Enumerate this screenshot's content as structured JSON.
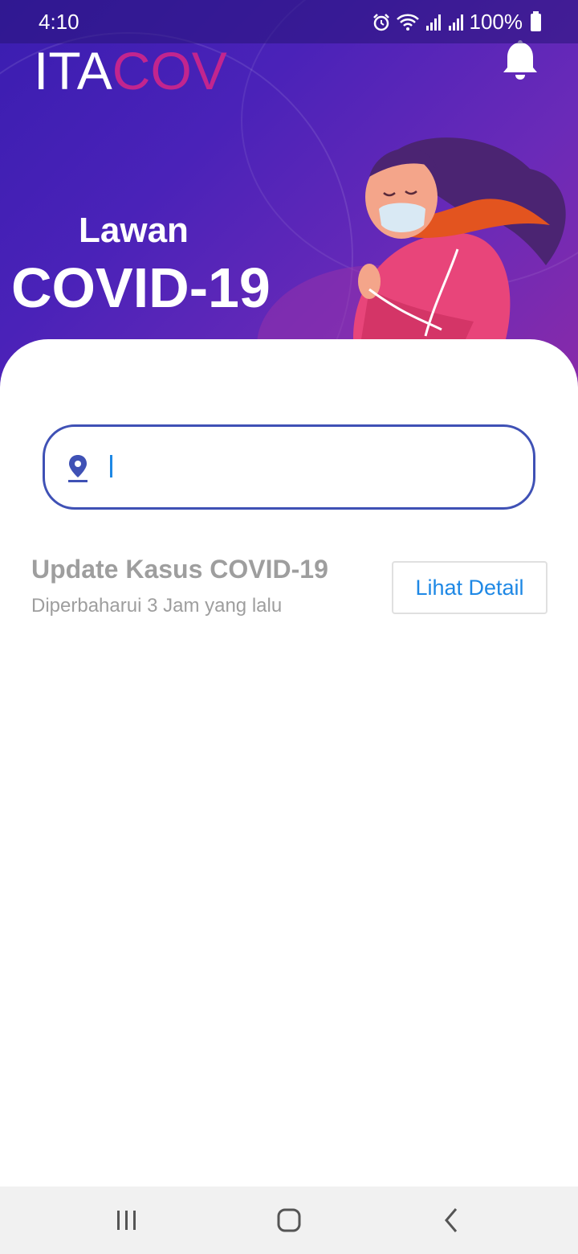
{
  "status_bar": {
    "time": "4:10",
    "battery": "100%",
    "icons": [
      "alarm-icon",
      "wifi-icon",
      "signal-icon",
      "signal-icon",
      "battery-icon"
    ]
  },
  "header": {
    "logo_part1": "ITA",
    "logo_part2": "COV",
    "bell_icon": "bell-icon"
  },
  "hero": {
    "line1": "Lawan",
    "line2": "COVID-19"
  },
  "search": {
    "icon": "location-pin-icon",
    "value": "",
    "placeholder": ""
  },
  "update": {
    "title": "Update Kasus COVID-19",
    "subtitle": "Diperbaharui 3 Jam yang lalu",
    "button_label": "Lihat Detail"
  },
  "navbar": {
    "items": [
      "recent-apps-icon",
      "home-icon",
      "back-icon"
    ]
  },
  "colors": {
    "brand_purple": "#3f51b5",
    "logo_accent": "#c2258e",
    "link_blue": "#1e88e5"
  }
}
